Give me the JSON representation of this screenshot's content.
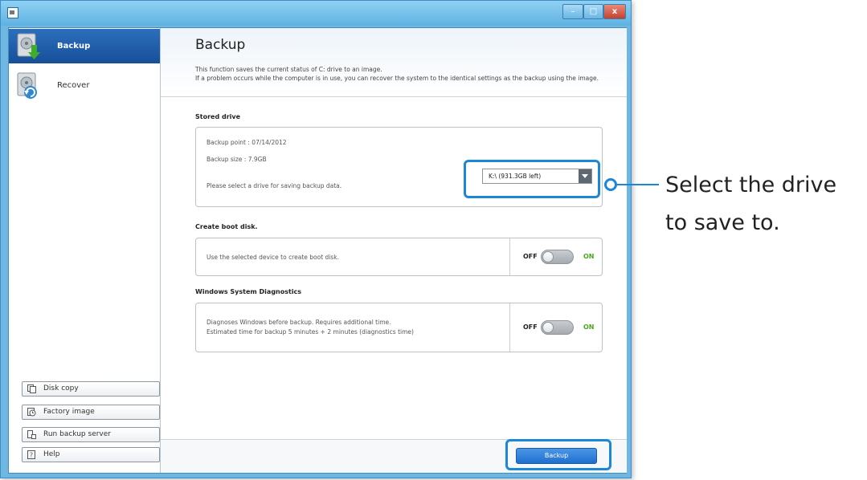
{
  "window": {
    "controls": {
      "minimize": "–",
      "maximize": "□",
      "close": "x"
    }
  },
  "sidebar": {
    "items": [
      {
        "label": "Backup",
        "icon": "backup-drive-icon",
        "active": true
      },
      {
        "label": "Recover",
        "icon": "recover-drive-icon",
        "active": false
      }
    ],
    "buttons": [
      {
        "label": "Disk copy",
        "icon": "disk-copy-icon"
      },
      {
        "label": "Factory image",
        "icon": "factory-image-icon"
      },
      {
        "label": "Run backup server",
        "icon": "backup-server-icon"
      },
      {
        "label": "Help",
        "icon": "help-icon"
      }
    ]
  },
  "header": {
    "title": "Backup",
    "desc_line1": "This function saves the current status of C: drive to an image.",
    "desc_line2": "If a problem occurs while the computer is in use, you can recover the system to the identical settings as the backup using the image."
  },
  "stored_drive": {
    "title": "Stored drive",
    "backup_point": "Backup point : 07/14/2012",
    "backup_size": "Backup size : 7.9GB",
    "select_text": "Please select a drive for saving backup data.",
    "selected_drive": "K:\\ (931.3GB left)"
  },
  "boot_disk": {
    "title": "Create boot disk.",
    "text": "Use the selected device to create boot disk.",
    "off_label": "OFF",
    "on_label": "ON",
    "state": "off"
  },
  "diagnostics": {
    "title": "Windows System Diagnostics",
    "text_line1": "Diagnoses Windows before backup. Requires additional time.",
    "text_line2": "Estimated time for backup 5 minutes + 2 minutes (diagnostics time)",
    "off_label": "OFF",
    "on_label": "ON",
    "state": "off"
  },
  "footer": {
    "backup_button": "Backup"
  },
  "annotation": {
    "line1": "Select the drive",
    "line2": "to save to."
  },
  "colors": {
    "accent": "#1c87d7",
    "sidebar_active": "#1f5fa8",
    "on_label": "#4aa61c",
    "close_button": "#c6402d"
  }
}
